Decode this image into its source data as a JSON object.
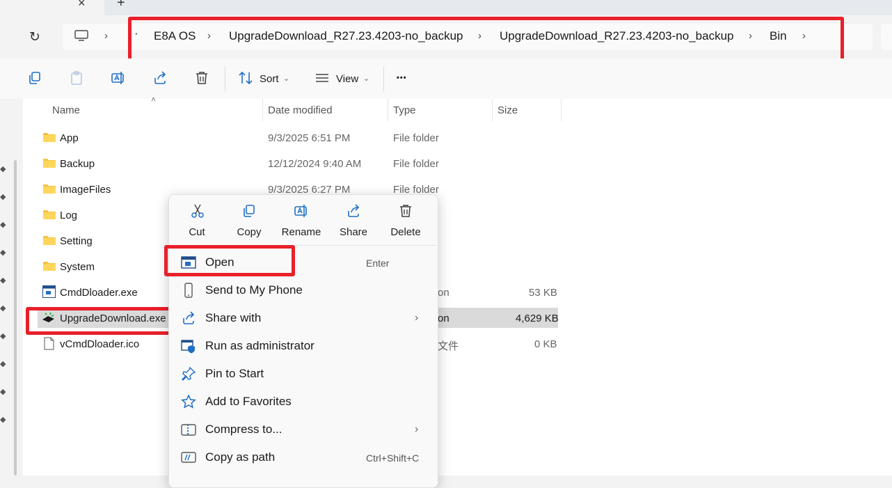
{
  "tab": {
    "close": "×",
    "new": "+"
  },
  "address": {
    "ellipsis": "·",
    "crumbs": [
      "E8A OS",
      "UpgradeDownload_R27.23.4203-no_backup",
      "UpgradeDownload_R27.23.4203-no_backup",
      "Bin"
    ],
    "separator": "›"
  },
  "toolbar": {
    "sort_label": "Sort",
    "view_label": "View",
    "more": "•••",
    "dropdown": "⌄"
  },
  "columns": {
    "name": "Name",
    "date": "Date modified",
    "type": "Type",
    "size": "Size"
  },
  "files": [
    {
      "name": "App",
      "date": "9/3/2025 6:51 PM",
      "type": "File folder",
      "size": "",
      "kind": "folder"
    },
    {
      "name": "Backup",
      "date": "12/12/2024 9:40 AM",
      "type": "File folder",
      "size": "",
      "kind": "folder"
    },
    {
      "name": "ImageFiles",
      "date": "9/3/2025 6:27 PM",
      "type": "File folder",
      "size": "",
      "kind": "folder"
    },
    {
      "name": "Log",
      "date": "",
      "type": "",
      "size": "",
      "kind": "folder"
    },
    {
      "name": "Setting",
      "date": "",
      "type": "",
      "size": "",
      "kind": "folder"
    },
    {
      "name": "System",
      "date": "",
      "type": "",
      "size": "",
      "kind": "folder"
    },
    {
      "name": "CmdDloader.exe",
      "date": "",
      "type": "on",
      "size": "53 KB",
      "kind": "exe"
    },
    {
      "name": "UpgradeDownload.exe",
      "date": "",
      "type": "on",
      "size": "4,629 KB",
      "kind": "app"
    },
    {
      "name": "vCmdDloader.ico",
      "date": "",
      "type": "文件",
      "size": "0 KB",
      "kind": "file"
    }
  ],
  "context_menu": {
    "quick_actions": [
      "Cut",
      "Copy",
      "Rename",
      "Share",
      "Delete"
    ],
    "items": [
      {
        "label": "Open",
        "shortcut": "Enter",
        "submenu": false
      },
      {
        "label": "Send to My Phone",
        "shortcut": "",
        "submenu": false
      },
      {
        "label": "Share with",
        "shortcut": "",
        "submenu": true
      },
      {
        "label": "Run as administrator",
        "shortcut": "",
        "submenu": false
      },
      {
        "label": "Pin to Start",
        "shortcut": "",
        "submenu": false
      },
      {
        "label": "Add to Favorites",
        "shortcut": "",
        "submenu": false
      },
      {
        "label": "Compress to...",
        "shortcut": "",
        "submenu": true
      },
      {
        "label": "Copy as path",
        "shortcut": "Ctrl+Shift+C",
        "submenu": false
      }
    ],
    "submenu_arrow": "›"
  },
  "colors": {
    "highlight_box": "#e8202a",
    "folder": "#f4c242",
    "accent": "#1f6fc5",
    "selection": "#dadada"
  }
}
